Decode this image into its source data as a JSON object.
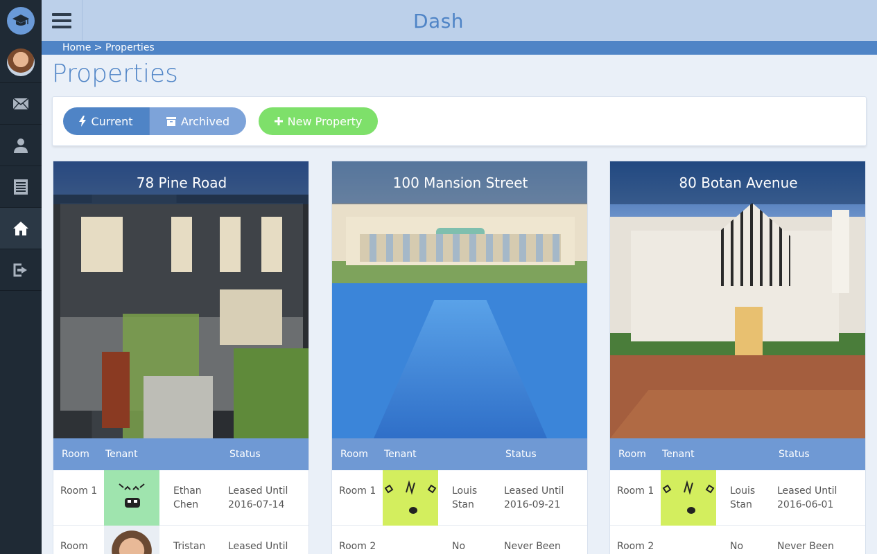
{
  "app": {
    "title": "Dash"
  },
  "breadcrumb": "Home > Properties",
  "page": {
    "title": "Properties"
  },
  "toolbar": {
    "current_label": "Current",
    "archived_label": "Archived",
    "new_property_label": "New Property"
  },
  "sidebar": {
    "items": [
      {
        "icon": "mail-icon"
      },
      {
        "icon": "user-icon"
      },
      {
        "icon": "list-icon"
      },
      {
        "icon": "home-icon",
        "active": true
      },
      {
        "icon": "logout-icon"
      }
    ]
  },
  "table_headers": {
    "room": "Room",
    "tenant": "Tenant",
    "status": "Status"
  },
  "properties": [
    {
      "name": "78 Pine Road",
      "rows": [
        {
          "room": "Room 1",
          "tenant": "Ethan Chen",
          "status": "Leased Until 2016-07-14"
        },
        {
          "room": "Room",
          "tenant": "Tristan",
          "status": "Leased Until"
        }
      ]
    },
    {
      "name": "100 Mansion Street",
      "rows": [
        {
          "room": "Room 1",
          "tenant": "Louis Stan",
          "status": "Leased Until 2016-09-21"
        },
        {
          "room": "Room 2",
          "tenant": "No Tenant",
          "status": "Never Been Leased"
        }
      ]
    },
    {
      "name": "80 Botan Avenue",
      "rows": [
        {
          "room": "Room 1",
          "tenant": "Louis Stan",
          "status": "Leased Until 2016-06-01"
        },
        {
          "room": "Room 2",
          "tenant": "No Tenant",
          "status": "Never Been Leased"
        }
      ]
    }
  ],
  "colors": {
    "accent": "#4f84c6",
    "sidebar": "#1f2a35",
    "new_button": "#7ee06a"
  }
}
